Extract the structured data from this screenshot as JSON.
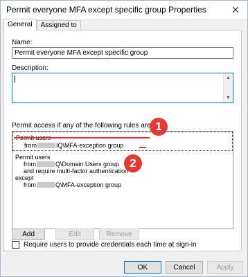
{
  "window": {
    "title": "Permit everyone MFA except specific group Properties",
    "close_icon": "close-icon"
  },
  "tabs": [
    {
      "label": "General",
      "active": true
    },
    {
      "label": "Assigned to",
      "active": false
    }
  ],
  "general": {
    "name_label": "Name:",
    "name_value": "Permit everyone MFA except specific group",
    "description_label": "Description:",
    "description_value": "",
    "rules_label": "Permit access if any of the following rules are met:",
    "rule1": {
      "line1": "Permit users",
      "line2_prefix": "from",
      "line2_suffix": "IQ\\MFA-exception group"
    },
    "rule2": {
      "line1": "Permit users",
      "line2_prefix": "from",
      "line2_suffix": "Q\\Domain Users group",
      "line3": "and require multi-factor authentication",
      "line4": "except",
      "line5_prefix": "from",
      "line5_suffix": "Q\\MFA-exception group"
    },
    "badges": [
      "1",
      "2"
    ],
    "buttons": {
      "add": "Add",
      "edit": "Edit",
      "remove": "Remove"
    },
    "checkbox_label": "Require users to provide credentials each time at sign-in",
    "checkbox_checked": false
  },
  "footer": {
    "ok": "OK",
    "cancel": "Cancel",
    "apply": "Apply"
  },
  "colors": {
    "accent": "#0078d7",
    "badge": "#e33b33",
    "window_bg": "#f0f0f0"
  }
}
